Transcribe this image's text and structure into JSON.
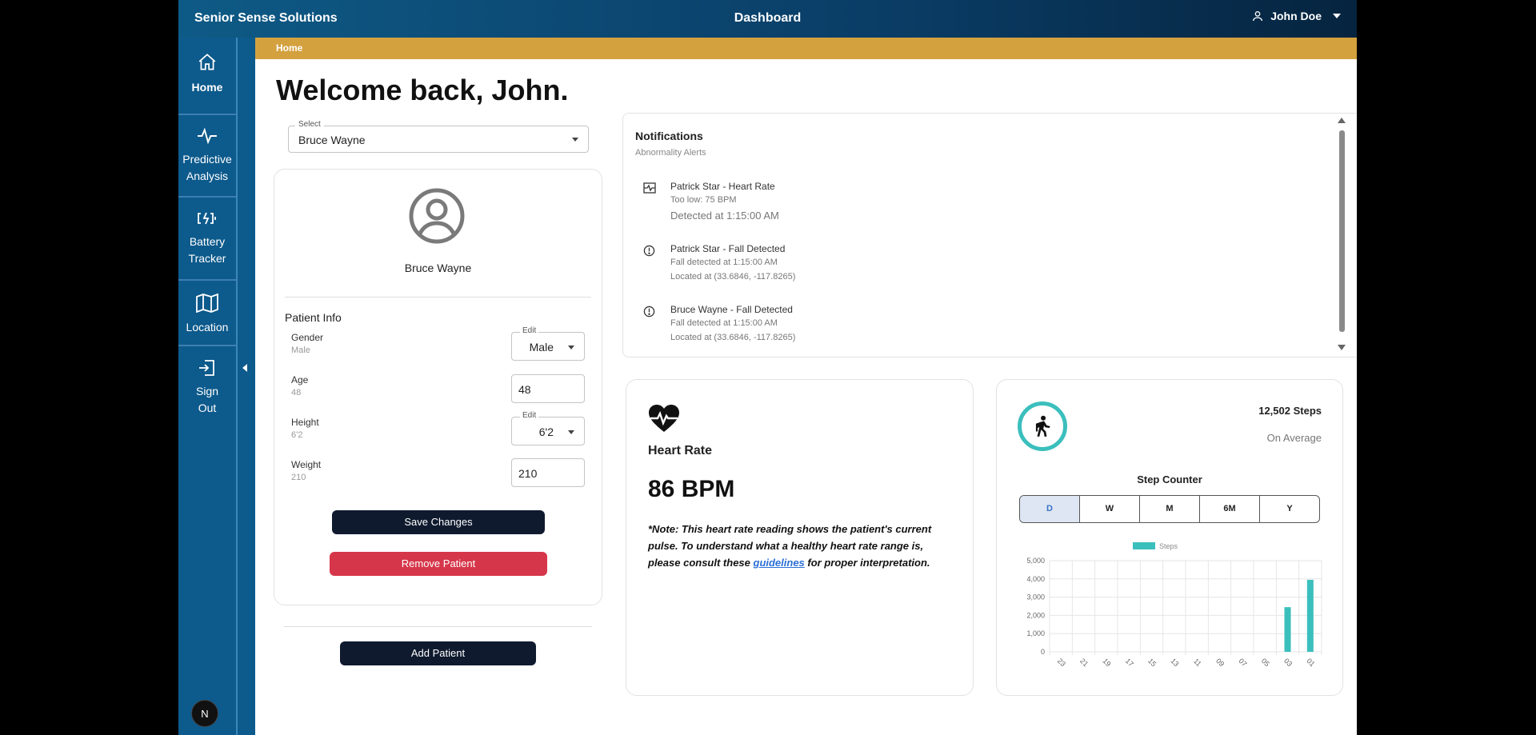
{
  "topbar": {
    "brand": "Senior Sense Solutions",
    "title": "Dashboard",
    "user": "John Doe"
  },
  "sidebar": {
    "items": [
      {
        "label": "Home",
        "icon": "home-icon"
      },
      {
        "label": "Predictive Analysis",
        "icon": "pulse-icon"
      },
      {
        "label": "Battery Tracker",
        "icon": "battery-charging-icon"
      },
      {
        "label": "Location",
        "icon": "map-icon"
      },
      {
        "label": "Sign Out",
        "icon": "sign-out-icon"
      }
    ],
    "badge": "N"
  },
  "breadcrumb": "Home",
  "welcome": "Welcome back, John.",
  "patient_select": {
    "label": "Select",
    "value": "Bruce Wayne"
  },
  "patient": {
    "name": "Bruce Wayne",
    "info_title": "Patient Info",
    "fields": {
      "gender": {
        "label": "Gender",
        "value": "Male",
        "edit_label": "Edit",
        "edit_value": "Male"
      },
      "age": {
        "label": "Age",
        "value": "48",
        "edit_value": "48"
      },
      "height": {
        "label": "Height",
        "value": "6'2",
        "edit_label": "Edit",
        "edit_value": "6'2"
      },
      "weight": {
        "label": "Weight",
        "value": "210",
        "edit_value": "210"
      }
    },
    "save_label": "Save Changes",
    "remove_label": "Remove Patient",
    "add_label": "Add Patient"
  },
  "notifications": {
    "title": "Notifications",
    "subtitle": "Abnormality Alerts",
    "items": [
      {
        "icon": "heart-rate-alert-icon",
        "head": "Patrick Star - Heart Rate",
        "line1": "Too low: 75 BPM",
        "line2": "Detected at 1:15:00 AM"
      },
      {
        "icon": "alert-circle-icon",
        "head": "Patrick Star - Fall Detected",
        "line1": "Fall detected at 1:15:00 AM",
        "line2": "Located at (33.6846, -117.8265)"
      },
      {
        "icon": "alert-circle-icon",
        "head": "Bruce Wayne - Fall Detected",
        "line1": "Fall detected at 1:15:00 AM",
        "line2": "Located at (33.6846, -117.8265)"
      }
    ]
  },
  "heart_rate": {
    "title": "Heart Rate",
    "value": "86 BPM",
    "note_before": "*Note: This heart rate reading shows the patient's current pulse. To understand what a healthy heart rate range is, please consult these ",
    "note_link": "guidelines",
    "note_after": " for proper interpretation."
  },
  "steps": {
    "total": "12,502 Steps",
    "average_label": "On Average",
    "counter_title": "Step Counter",
    "ranges": [
      "D",
      "W",
      "M",
      "6M",
      "Y"
    ],
    "active_range": "D",
    "accent": "#3bbfbd"
  },
  "chart_data": {
    "type": "bar",
    "legend": [
      "Steps"
    ],
    "categories": [
      "23",
      "21",
      "19",
      "17",
      "15",
      "13",
      "11",
      "09",
      "07",
      "05",
      "03",
      "01"
    ],
    "series": [
      {
        "name": "Steps",
        "values": [
          0,
          0,
          0,
          0,
          0,
          0,
          0,
          0,
          0,
          0,
          2450,
          3950
        ]
      }
    ],
    "yticks": [
      "0",
      "1,000",
      "2,000",
      "3,000",
      "4,000",
      "5,000"
    ],
    "ylim": [
      0,
      5000
    ],
    "grid": true,
    "legend_position": "top"
  }
}
